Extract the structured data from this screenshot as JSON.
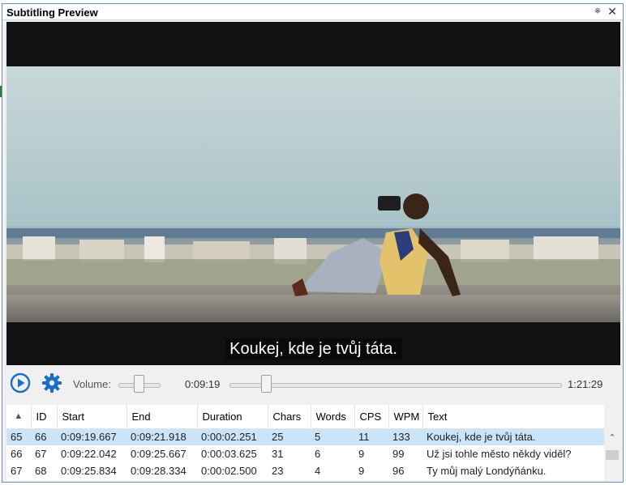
{
  "window": {
    "title": "Subtitling Preview",
    "pin_icon": "pin-icon",
    "close_icon": "close-icon"
  },
  "video": {
    "subtitle": "Koukej, kde je tvůj táta."
  },
  "controls": {
    "play_icon": "play-circle-icon",
    "settings_icon": "gear-icon",
    "volume_label": "Volume:",
    "volume_level": 0.5,
    "current_time": "0:09:19",
    "total_time": "1:21:29",
    "position_fraction": 0.114,
    "accent": "#1a6fc4"
  },
  "grid": {
    "columns": [
      "",
      "ID",
      "Start",
      "End",
      "Duration",
      "Chars",
      "Words",
      "CPS",
      "WPM",
      "Text"
    ],
    "sort_icon": "▲",
    "rows": [
      {
        "row_no": "65",
        "id": "66",
        "start": "0:09:19.667",
        "end": "0:09:21.918",
        "duration": "0:00:02.251",
        "chars": "25",
        "words": "5",
        "cps": "11",
        "wpm": "133",
        "text": "Koukej, kde je tvůj táta.",
        "selected": true
      },
      {
        "row_no": "66",
        "id": "67",
        "start": "0:09:22.042",
        "end": "0:09:25.667",
        "duration": "0:00:03.625",
        "chars": "31",
        "words": "6",
        "cps": "9",
        "wpm": "99",
        "text": "Už jsi tohle město někdy viděl?",
        "selected": false
      },
      {
        "row_no": "67",
        "id": "68",
        "start": "0:09:25.834",
        "end": "0:09:28.334",
        "duration": "0:00:02.500",
        "chars": "23",
        "words": "4",
        "cps": "9",
        "wpm": "96",
        "text": "Ty můj malý Londýňánku.",
        "selected": false
      }
    ],
    "selected_color": "#cce4f7"
  }
}
